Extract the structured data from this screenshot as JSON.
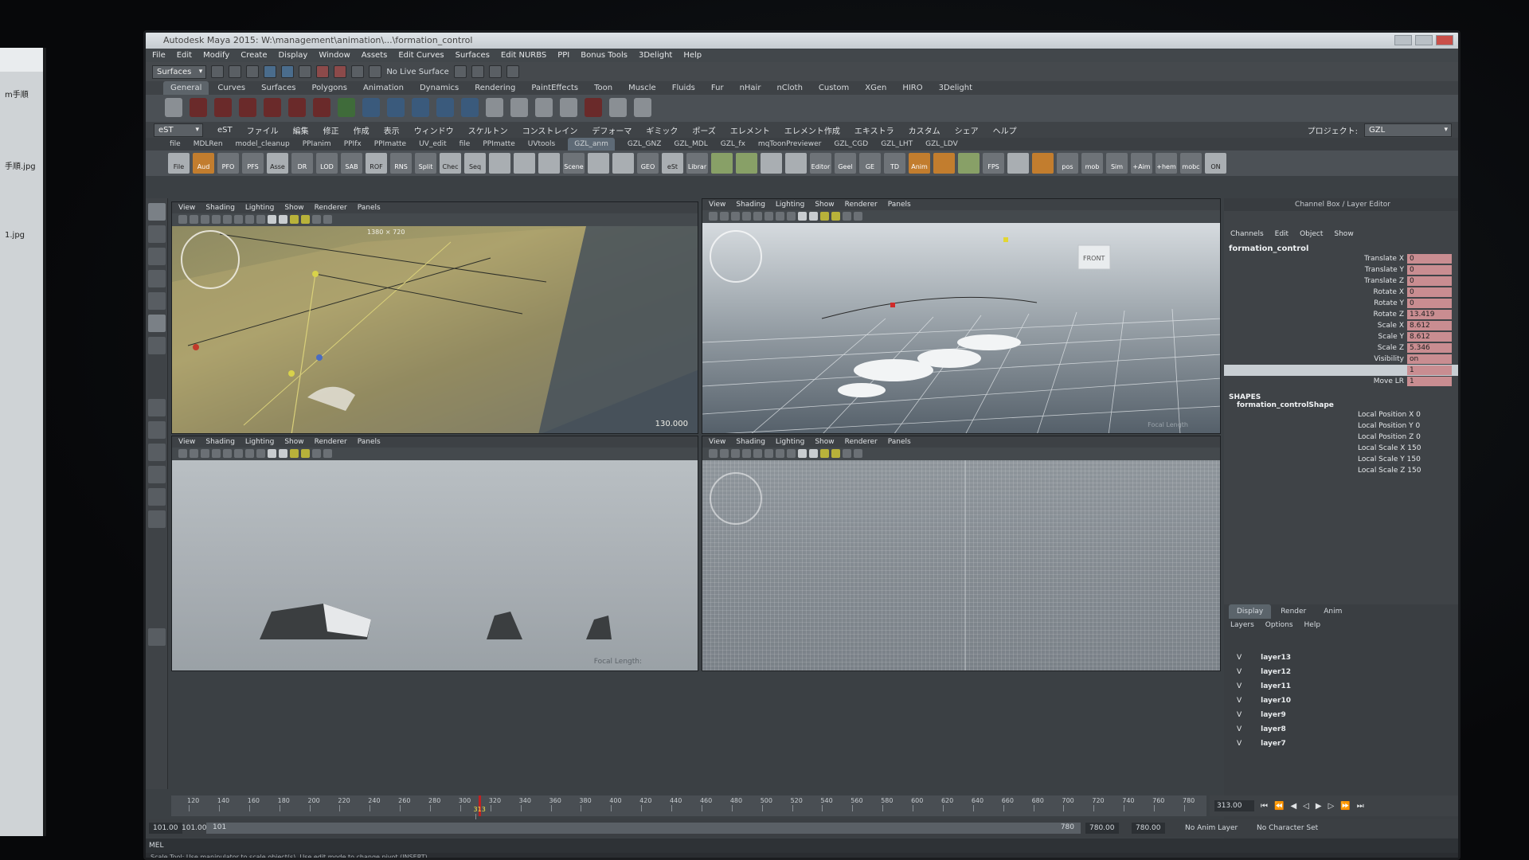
{
  "window": {
    "title": "Autodesk Maya 2015: W:\\management\\animation\\...\\formation_control"
  },
  "side_monitor": {
    "files": [
      "m手順",
      "手順.jpg",
      "1.jpg"
    ]
  },
  "menubar": [
    "File",
    "Edit",
    "Modify",
    "Create",
    "Display",
    "Window",
    "Assets",
    "Edit Curves",
    "Surfaces",
    "Edit NURBS",
    "PPI",
    "Bonus Tools",
    "3Delight",
    "Help"
  ],
  "status_line": {
    "mode": "Surfaces",
    "live": "No Live Surface"
  },
  "shelf_tabs": [
    "General",
    "Curves",
    "Surfaces",
    "Polygons",
    "Animation",
    "Dynamics",
    "Rendering",
    "PaintEffects",
    "Toon",
    "Muscle",
    "Fluids",
    "Fur",
    "nHair",
    "nCloth",
    "Custom",
    "XGen",
    "HIRO",
    "3Delight"
  ],
  "jp_menu": {
    "dropdown": "eST",
    "items": [
      "eST",
      "ファイル",
      "編集",
      "修正",
      "作成",
      "表示",
      "ウィンドウ",
      "スケルトン",
      "コンストレイン",
      "デフォーマ",
      "ギミック",
      "ポーズ",
      "エレメント",
      "エレメント作成",
      "エキストラ",
      "カスタム",
      "シェア",
      "ヘルプ"
    ],
    "project_label": "プロジェクト:",
    "project_value": "GZL"
  },
  "shelf2_tabs": [
    "file",
    "MDLRen",
    "model_cleanup",
    "PPIanim",
    "PPIfx",
    "PPImatte",
    "UV_edit",
    "file",
    "PPImatte",
    "UVtools",
    "GZL_anm",
    "GZL_GNZ",
    "GZL_MDL",
    "GZL_fx",
    "mqToonPreviewer",
    "GZL_CGD",
    "GZL_LHT",
    "GZL_LDV"
  ],
  "shelf2_icons": [
    "File",
    "Aud",
    "PFO",
    "PFS",
    "Asse",
    "DR",
    "LOD",
    "SAB",
    "ROF",
    "RNS",
    "Split",
    "Chec",
    "Seq",
    "",
    "",
    "",
    "Scene",
    "",
    "",
    "GEO",
    "eSt",
    "Librar",
    "",
    "",
    "",
    "",
    "Editor",
    "Geel",
    "GE",
    "TD",
    "Anim",
    "",
    "",
    "FPS",
    "",
    "",
    "pos",
    "mob",
    "Sim",
    "+Aim",
    "+hem",
    "mobc",
    "ON"
  ],
  "viewport_menu": [
    "View",
    "Shading",
    "Lighting",
    "Show",
    "Renderer",
    "Panels"
  ],
  "viewports": {
    "top_left": {
      "resolution": "1380 × 720",
      "focal": "130.000"
    },
    "top_right": {
      "cube": "FRONT",
      "label": "Focal Length"
    },
    "bottom_left": {
      "label": "Focal Length:"
    },
    "bottom_right": {
      "label": ""
    }
  },
  "channel_box": {
    "title": "Channel Box / Layer Editor",
    "menu": [
      "Channels",
      "Edit",
      "Object",
      "Show"
    ],
    "node": "formation_control",
    "attributes": [
      {
        "label": "Translate X",
        "value": "0"
      },
      {
        "label": "Translate Y",
        "value": "0"
      },
      {
        "label": "Translate Z",
        "value": "0"
      },
      {
        "label": "Rotate X",
        "value": "0"
      },
      {
        "label": "Rotate Y",
        "value": "0"
      },
      {
        "label": "Rotate Z",
        "value": "13.419"
      },
      {
        "label": "Scale X",
        "value": "8.612"
      },
      {
        "label": "Scale Y",
        "value": "8.612"
      },
      {
        "label": "Scale Z",
        "value": "5.346"
      },
      {
        "label": "Visibility",
        "value": "on"
      },
      {
        "label": "Interval",
        "value": "1"
      },
      {
        "label": "Move LR",
        "value": "1"
      }
    ],
    "shapes_header": "SHAPES",
    "shape_name": "formation_controlShape",
    "shape_attrs": [
      "Local Position X 0",
      "Local Position Y 0",
      "Local Position Z 0",
      "Local Scale X 150",
      "Local Scale Y 150",
      "Local Scale Z 150"
    ]
  },
  "layer_editor": {
    "tabs": [
      "Display",
      "Render",
      "Anim"
    ],
    "menu": [
      "Layers",
      "Options",
      "Help"
    ],
    "layers": [
      "layer13",
      "layer12",
      "layer11",
      "layer10",
      "layer9",
      "layer8",
      "layer7"
    ]
  },
  "timeline": {
    "ticks": [
      "120",
      "140",
      "160",
      "180",
      "200",
      "220",
      "240",
      "260",
      "280",
      "300",
      "320",
      "340",
      "360",
      "380",
      "400",
      "420",
      "440",
      "460",
      "480",
      "500",
      "520",
      "540",
      "560",
      "580",
      "600",
      "620",
      "640",
      "660",
      "680",
      "700",
      "720",
      "740",
      "760",
      "780"
    ],
    "current_label": "313",
    "current_frame": "313.00"
  },
  "range": {
    "start_a": "101.00",
    "start_b": "101.00",
    "slider_start": "101",
    "slider_end": "780",
    "end_a": "780.00",
    "end_b": "780.00",
    "anim_layer": "No Anim Layer",
    "char_set": "No Character Set"
  },
  "cmd": {
    "label": "MEL"
  },
  "help": {
    "text": "Scale Tool: Use manipulator to scale object(s). Use edit mode to change pivot (INSERT)."
  }
}
